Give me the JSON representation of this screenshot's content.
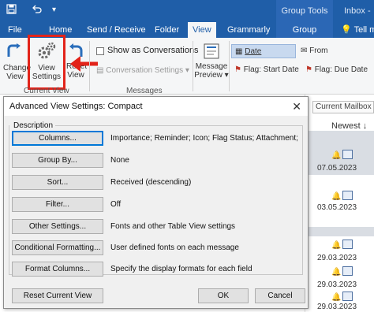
{
  "titlebar": {
    "group_tools": "Group Tools",
    "inbox": "Inbox -",
    "icons": [
      "save-icon",
      "undo-icon",
      "dropdown-icon"
    ]
  },
  "tabs": {
    "file": "File",
    "home": "Home",
    "send_receive": "Send / Receive",
    "folder": "Folder",
    "view": "View",
    "grammarly": "Grammarly",
    "group": "Group",
    "tell_me": "Tell me"
  },
  "ribbon": {
    "change_view": [
      "Change",
      "View"
    ],
    "view_settings": [
      "View",
      "Settings"
    ],
    "reset_view": [
      "Reset",
      "View"
    ],
    "current_view_label": "Current View",
    "show_as_conversations": "Show as Conversations",
    "conversation_settings": "Conversation Settings",
    "messages_label": "Messages",
    "message_preview": [
      "Message",
      "Preview"
    ],
    "arrangement": {
      "date": "Date",
      "from": "From",
      "flag_start": "Flag: Start Date",
      "flag_due": "Flag: Due Date"
    }
  },
  "mailbox": {
    "current_mailbox": "Current Mailbox",
    "newest": "Newest",
    "dates": [
      "07.05.2023",
      "03.05.2023",
      "29.03.2023",
      "29.03.2023",
      "29.03.2023"
    ]
  },
  "dialog": {
    "title": "Advanced View Settings: Compact",
    "description_label": "Description",
    "rows": [
      {
        "button": "Columns...",
        "value": "Importance; Reminder; Icon; Flag Status; Attachment; Fr..."
      },
      {
        "button": "Group By...",
        "value": "None"
      },
      {
        "button": "Sort...",
        "value": "Received (descending)"
      },
      {
        "button": "Filter...",
        "value": "Off"
      },
      {
        "button": "Other Settings...",
        "value": "Fonts and other Table View settings"
      },
      {
        "button": "Conditional Formatting...",
        "value": "User defined fonts on each message"
      },
      {
        "button": "Format Columns...",
        "value": "Specify the display formats for each field"
      }
    ],
    "reset_button": "Reset Current View",
    "ok_button": "OK",
    "cancel_button": "Cancel"
  },
  "colors": {
    "title_blue": "#1f5ea8",
    "highlight_red": "#e2231a"
  }
}
